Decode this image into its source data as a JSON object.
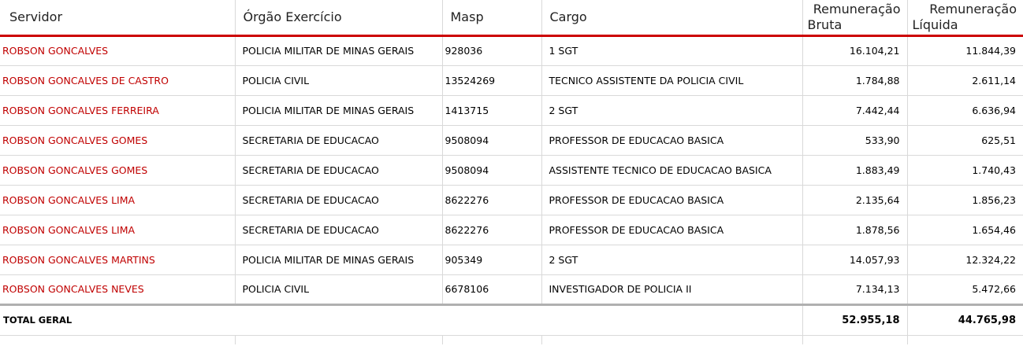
{
  "headers": {
    "servidor": "Servidor",
    "orgao": "Órgão Exercício",
    "masp": "Masp",
    "cargo": "Cargo",
    "bruta_1": "Remuneração",
    "bruta_2": "Bruta",
    "liquida_1": "Remuneração",
    "liquida_2": "Líquida"
  },
  "rows": [
    {
      "servidor": "ROBSON GONCALVES",
      "orgao": "POLICIA MILITAR DE MINAS GERAIS",
      "masp": "928036",
      "cargo": "1 SGT",
      "bruta": "16.104,21",
      "liquida": "11.844,39"
    },
    {
      "servidor": "ROBSON GONCALVES DE CASTRO",
      "orgao": "POLICIA CIVIL",
      "masp": "13524269",
      "cargo": "TECNICO ASSISTENTE DA POLICIA CIVIL",
      "bruta": "1.784,88",
      "liquida": "2.611,14"
    },
    {
      "servidor": "ROBSON GONCALVES FERREIRA",
      "orgao": "POLICIA MILITAR DE MINAS GERAIS",
      "masp": "1413715",
      "cargo": "2 SGT",
      "bruta": "7.442,44",
      "liquida": "6.636,94"
    },
    {
      "servidor": "ROBSON GONCALVES GOMES",
      "orgao": "SECRETARIA DE EDUCACAO",
      "masp": "9508094",
      "cargo": "PROFESSOR DE EDUCACAO BASICA",
      "bruta": "533,90",
      "liquida": "625,51"
    },
    {
      "servidor": "ROBSON GONCALVES GOMES",
      "orgao": "SECRETARIA DE EDUCACAO",
      "masp": "9508094",
      "cargo": "ASSISTENTE TECNICO DE EDUCACAO BASICA",
      "bruta": "1.883,49",
      "liquida": "1.740,43"
    },
    {
      "servidor": "ROBSON GONCALVES LIMA",
      "orgao": "SECRETARIA DE EDUCACAO",
      "masp": "8622276",
      "cargo": "PROFESSOR DE EDUCACAO BASICA",
      "bruta": "2.135,64",
      "liquida": "1.856,23"
    },
    {
      "servidor": "ROBSON GONCALVES LIMA",
      "orgao": "SECRETARIA DE EDUCACAO",
      "masp": "8622276",
      "cargo": "PROFESSOR DE EDUCACAO BASICA",
      "bruta": "1.878,56",
      "liquida": "1.654,46"
    },
    {
      "servidor": "ROBSON GONCALVES MARTINS",
      "orgao": "POLICIA MILITAR DE MINAS GERAIS",
      "masp": "905349",
      "cargo": "2 SGT",
      "bruta": "14.057,93",
      "liquida": "12.324,22"
    },
    {
      "servidor": "ROBSON GONCALVES NEVES",
      "orgao": "POLICIA CIVIL",
      "masp": "6678106",
      "cargo": "INVESTIGADOR DE POLICIA II",
      "bruta": "7.134,13",
      "liquida": "5.472,66"
    }
  ],
  "total": {
    "label": "TOTAL GERAL",
    "bruta": "52.955,18",
    "liquida": "44.765,98"
  },
  "colors": {
    "name_link": "#c00000",
    "header_rule": "#cc0000"
  }
}
